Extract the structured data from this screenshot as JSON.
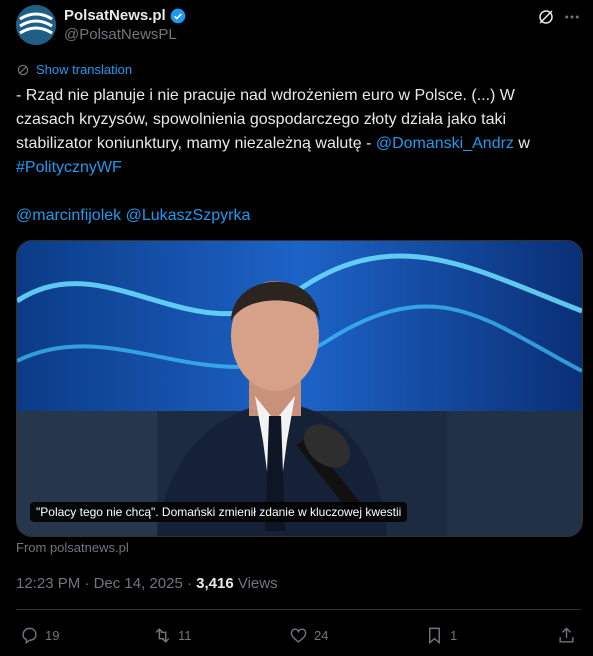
{
  "header": {
    "display_name": "PolsatNews.pl",
    "handle": "@PolsatNewsPL"
  },
  "tweet": {
    "show_translation": "Show translation",
    "text_main": "- Rząd nie planuje i nie pracuje nad wdrożeniem euro w Polsce. (...) W czasach kryzysów, spowolnienia gospodarczego złoty działa jako taki stabilizator koniunktury, mamy niezależną walutę - ",
    "mention_1": "@Domanski_Andrz",
    "text_in": " w ",
    "hashtag": "#PolitycznyWF",
    "mention_2": "@marcinfijolek",
    "mention_3": "@LukaszSzpyrka"
  },
  "card": {
    "caption": "\"Polacy tego nie chcą\". Domański zmienił zdanie w kluczowej kwestii",
    "source": "From polsatnews.pl"
  },
  "meta": {
    "time": "12:23 PM",
    "sep1": " · ",
    "date": "Dec 14, 2025",
    "sep2": " · ",
    "views_count": "3,416",
    "views_label": " Views"
  },
  "actions": {
    "replies": "19",
    "reposts": "11",
    "likes": "24",
    "bookmarks": "1"
  },
  "colors": {
    "background": "#000000",
    "link": "#1d9bf0",
    "muted": "#71767b",
    "text": "#e7e9ea"
  }
}
